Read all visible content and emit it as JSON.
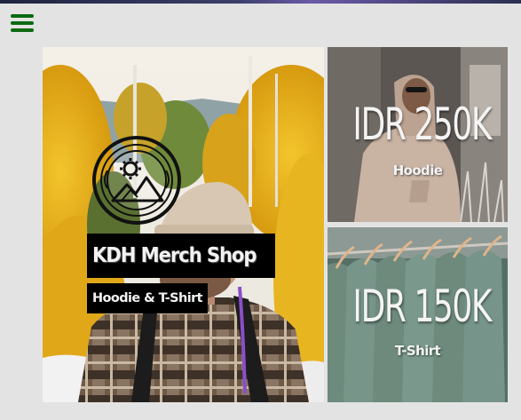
{
  "nav": {
    "menu_icon": "hamburger-menu-icon",
    "accent": "#0a6a12"
  },
  "hero": {
    "logo_icon": "mountain-gear-emblem-icon",
    "title": "KDH Merch Shop",
    "subtitle": "Hoodie & T-Shirt"
  },
  "products": [
    {
      "price": "IDR 250K",
      "label": "Hoodie"
    },
    {
      "price": "IDR 150K",
      "label": "T-Shirt"
    }
  ]
}
